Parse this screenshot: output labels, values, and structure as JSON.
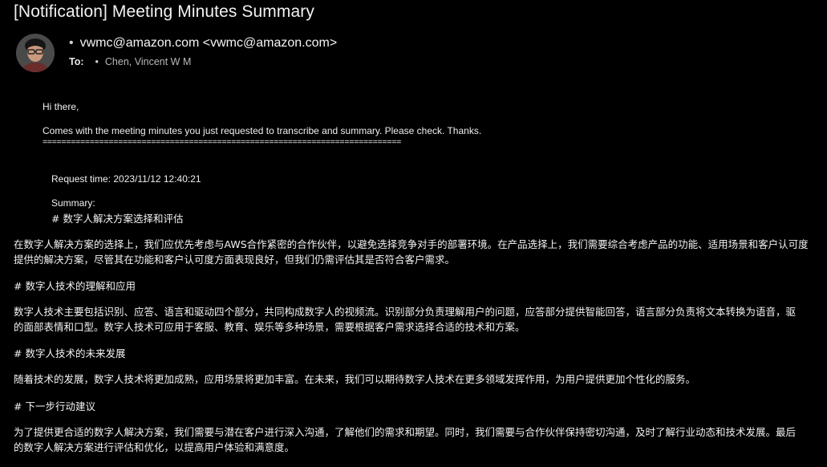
{
  "email": {
    "subject": "[Notification] Meeting Minutes Summary",
    "sender": "vwmc@amazon.com <vwmc@amazon.com>",
    "to_label": "To:",
    "recipients": [
      "Chen, Vincent W M"
    ]
  },
  "body": {
    "greeting": "Hi there,",
    "intro": "Comes with the meeting minutes you just requested to transcribe and summary. Please check. Thanks.",
    "separator": "============================================================================",
    "request_time": "Request time: 2023/11/12 12:40:21",
    "summary_label": "Summary:",
    "sections": [
      {
        "heading": "# 数字人解决方案选择和评估",
        "lines": [
          "在数字人解决方案的选择上，我们应优先考虑与AWS合作紧密的合作伙伴，以避免选择竞争对手的部署环境。在产品选择上，我们需要综合考虑产品的功能、适用场景和客户认可度",
          "提供的解决方案，尽管其在功能和客户认可度方面表现良好，但我们仍需评估其是否符合客户需求。"
        ]
      },
      {
        "heading": "# 数字人技术的理解和应用",
        "lines": [
          "数字人技术主要包括识别、应答、语言和驱动四个部分，共同构成数字人的视频流。识别部分负责理解用户的问题，应答部分提供智能回答，语言部分负责将文本转换为语音，驱",
          "的面部表情和口型。数字人技术可应用于客服、教育、娱乐等多种场景，需要根据客户需求选择合适的技术和方案。"
        ]
      },
      {
        "heading": "# 数字人技术的未来发展",
        "lines": [
          "随着技术的发展，数字人技术将更加成熟，应用场景将更加丰富。在未来，我们可以期待数字人技术在更多领域发挥作用，为用户提供更加个性化的服务。"
        ]
      },
      {
        "heading": "# 下一步行动建议",
        "lines": [
          "为了提供更合适的数字人解决方案，我们需要与潜在客户进行深入沟通，了解他们的需求和期望。同时，我们需要与合作伙伴保持密切沟通，及时了解行业动态和技术发展。最后",
          "的数字人解决方案进行评估和优化，以提高用户体验和满意度。"
        ]
      }
    ]
  },
  "colors": {
    "background": "#000000",
    "text": "#f0f0f0",
    "muted": "#b8b8b8"
  }
}
